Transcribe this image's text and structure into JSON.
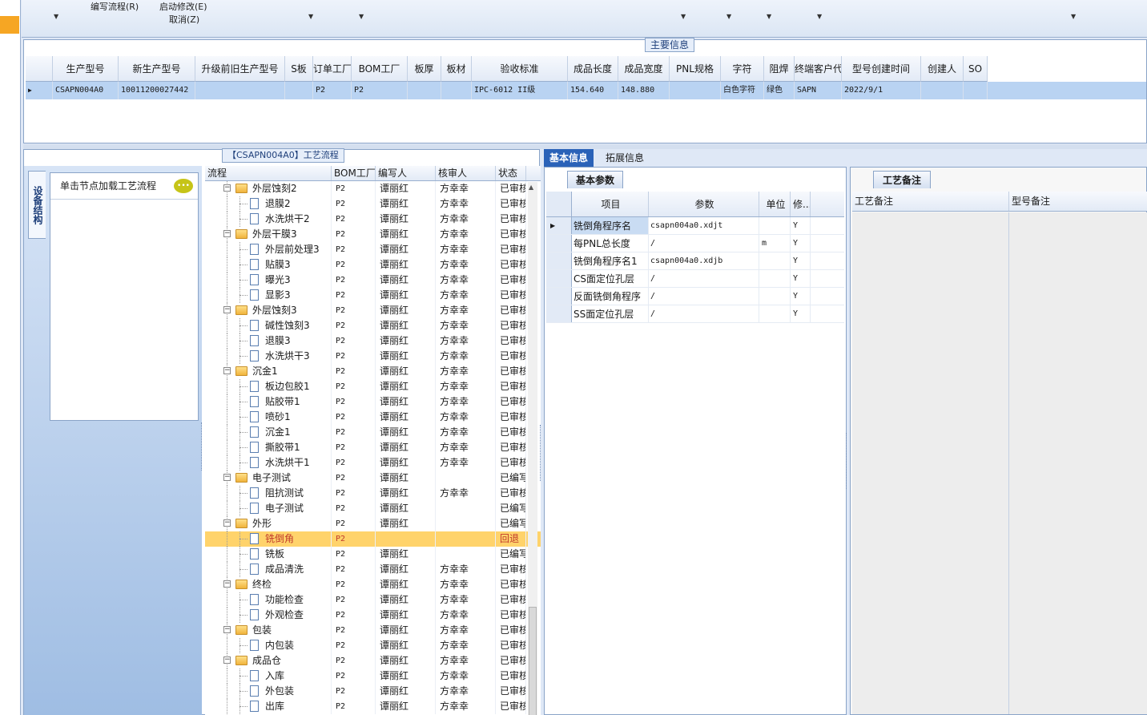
{
  "toolbar": {
    "write_flow": "编写流程(R)",
    "start_modify": "启动修改(E)",
    "cancel": "取消(Z)"
  },
  "main_info": {
    "title": "主要信息",
    "columns": [
      "生产型号",
      "新生产型号",
      "升级前旧生产型号",
      "S板",
      "订单工厂",
      "BOM工厂",
      "板厚",
      "板材",
      "验收标准",
      "成品长度",
      "成品宽度",
      "PNL规格",
      "字符",
      "阻焊",
      "终端客户代码",
      "型号创建时间",
      "创建人",
      "SO"
    ],
    "row": [
      "CSAPN004A0",
      "10011200027442",
      "",
      "",
      "P2",
      "P2",
      "",
      "",
      "IPC-6012 II级",
      "154.640",
      "148.880",
      "",
      "白色字符",
      "绿色",
      "SAPN",
      "2022/9/1",
      "",
      ""
    ]
  },
  "flow_panel": {
    "title": "【CSAPN004A0】工艺流程",
    "side_tab": "设备结构",
    "node_hint": "单击节点加载工艺流程",
    "tree_columns": [
      "流程",
      "BOM工厂",
      "编写人",
      "核审人",
      "状态"
    ],
    "rows": [
      {
        "name": "外层蚀刻2",
        "level": 1,
        "bom": "P2",
        "writer": "谭丽红",
        "checker": "方幸幸",
        "status": "已审核"
      },
      {
        "name": "退膜2",
        "level": 2,
        "bom": "P2",
        "writer": "谭丽红",
        "checker": "方幸幸",
        "status": "已审核"
      },
      {
        "name": "水洗烘干2",
        "level": 2,
        "bom": "P2",
        "writer": "谭丽红",
        "checker": "方幸幸",
        "status": "已审核"
      },
      {
        "name": "外层干膜3",
        "level": 1,
        "bom": "P2",
        "writer": "谭丽红",
        "checker": "方幸幸",
        "status": "已审核"
      },
      {
        "name": "外层前处理3",
        "level": 2,
        "bom": "P2",
        "writer": "谭丽红",
        "checker": "方幸幸",
        "status": "已审核"
      },
      {
        "name": "贴膜3",
        "level": 2,
        "bom": "P2",
        "writer": "谭丽红",
        "checker": "方幸幸",
        "status": "已审核"
      },
      {
        "name": "曝光3",
        "level": 2,
        "bom": "P2",
        "writer": "谭丽红",
        "checker": "方幸幸",
        "status": "已审核"
      },
      {
        "name": "显影3",
        "level": 2,
        "bom": "P2",
        "writer": "谭丽红",
        "checker": "方幸幸",
        "status": "已审核"
      },
      {
        "name": "外层蚀刻3",
        "level": 1,
        "bom": "P2",
        "writer": "谭丽红",
        "checker": "方幸幸",
        "status": "已审核"
      },
      {
        "name": "碱性蚀刻3",
        "level": 2,
        "bom": "P2",
        "writer": "谭丽红",
        "checker": "方幸幸",
        "status": "已审核"
      },
      {
        "name": "退膜3",
        "level": 2,
        "bom": "P2",
        "writer": "谭丽红",
        "checker": "方幸幸",
        "status": "已审核"
      },
      {
        "name": "水洗烘干3",
        "level": 2,
        "bom": "P2",
        "writer": "谭丽红",
        "checker": "方幸幸",
        "status": "已审核"
      },
      {
        "name": "沉金1",
        "level": 1,
        "bom": "P2",
        "writer": "谭丽红",
        "checker": "方幸幸",
        "status": "已审核"
      },
      {
        "name": "板边包胶1",
        "level": 2,
        "bom": "P2",
        "writer": "谭丽红",
        "checker": "方幸幸",
        "status": "已审核"
      },
      {
        "name": "贴胶带1",
        "level": 2,
        "bom": "P2",
        "writer": "谭丽红",
        "checker": "方幸幸",
        "status": "已审核"
      },
      {
        "name": "喷砂1",
        "level": 2,
        "bom": "P2",
        "writer": "谭丽红",
        "checker": "方幸幸",
        "status": "已审核"
      },
      {
        "name": "沉金1",
        "level": 2,
        "bom": "P2",
        "writer": "谭丽红",
        "checker": "方幸幸",
        "status": "已审核"
      },
      {
        "name": "撕胶带1",
        "level": 2,
        "bom": "P2",
        "writer": "谭丽红",
        "checker": "方幸幸",
        "status": "已审核"
      },
      {
        "name": "水洗烘干1",
        "level": 2,
        "bom": "P2",
        "writer": "谭丽红",
        "checker": "方幸幸",
        "status": "已审核"
      },
      {
        "name": "电子测试",
        "level": 1,
        "bom": "P2",
        "writer": "谭丽红",
        "checker": "",
        "status": "已编写"
      },
      {
        "name": "阻抗测试",
        "level": 2,
        "bom": "P2",
        "writer": "谭丽红",
        "checker": "方幸幸",
        "status": "已审核"
      },
      {
        "name": "电子测试",
        "level": 2,
        "bom": "P2",
        "writer": "谭丽红",
        "checker": "",
        "status": "已编写"
      },
      {
        "name": "外形",
        "level": 1,
        "bom": "P2",
        "writer": "谭丽红",
        "checker": "",
        "status": "已编写"
      },
      {
        "name": "铣倒角",
        "level": 2,
        "bom": "P2",
        "writer": "",
        "checker": "",
        "status": "回退",
        "highlight": true
      },
      {
        "name": "铣板",
        "level": 2,
        "bom": "P2",
        "writer": "谭丽红",
        "checker": "",
        "status": "已编写"
      },
      {
        "name": "成品清洗",
        "level": 2,
        "bom": "P2",
        "writer": "谭丽红",
        "checker": "方幸幸",
        "status": "已审核"
      },
      {
        "name": "终检",
        "level": 1,
        "bom": "P2",
        "writer": "谭丽红",
        "checker": "方幸幸",
        "status": "已审核"
      },
      {
        "name": "功能检查",
        "level": 2,
        "bom": "P2",
        "writer": "谭丽红",
        "checker": "方幸幸",
        "status": "已审核"
      },
      {
        "name": "外观检查",
        "level": 2,
        "bom": "P2",
        "writer": "谭丽红",
        "checker": "方幸幸",
        "status": "已审核"
      },
      {
        "name": "包装",
        "level": 1,
        "bom": "P2",
        "writer": "谭丽红",
        "checker": "方幸幸",
        "status": "已审核"
      },
      {
        "name": "内包装",
        "level": 2,
        "bom": "P2",
        "writer": "谭丽红",
        "checker": "方幸幸",
        "status": "已审核"
      },
      {
        "name": "成品仓",
        "level": 1,
        "bom": "P2",
        "writer": "谭丽红",
        "checker": "方幸幸",
        "status": "已审核"
      },
      {
        "name": "入库",
        "level": 2,
        "bom": "P2",
        "writer": "谭丽红",
        "checker": "方幸幸",
        "status": "已审核"
      },
      {
        "name": "外包装",
        "level": 2,
        "bom": "P2",
        "writer": "谭丽红",
        "checker": "方幸幸",
        "status": "已审核"
      },
      {
        "name": "出库",
        "level": 2,
        "bom": "P2",
        "writer": "谭丽红",
        "checker": "方幸幸",
        "status": "已审核"
      }
    ]
  },
  "mid_panel": {
    "tabs": [
      "基本信息",
      "拓展信息"
    ],
    "sub_tab": "基本参数",
    "columns": [
      "项目",
      "参数",
      "单位",
      "修..."
    ],
    "rows": [
      {
        "item": "铣倒角程序名",
        "value": "csapn004a0.xdjt",
        "unit": "",
        "mod": "Y"
      },
      {
        "item": "每PNL总长度",
        "value": "/",
        "unit": "m",
        "mod": "Y"
      },
      {
        "item": "铣倒角程序名1",
        "value": "csapn004a0.xdjb",
        "unit": "",
        "mod": "Y"
      },
      {
        "item": "CS面定位孔层",
        "value": "/",
        "unit": "",
        "mod": "Y"
      },
      {
        "item": "反面铣倒角程序",
        "value": "/",
        "unit": "",
        "mod": "Y"
      },
      {
        "item": "SS面定位孔层",
        "value": "/",
        "unit": "",
        "mod": "Y"
      }
    ]
  },
  "right_panel": {
    "tab": "工艺备注",
    "columns": [
      "工艺备注",
      "型号备注"
    ]
  }
}
